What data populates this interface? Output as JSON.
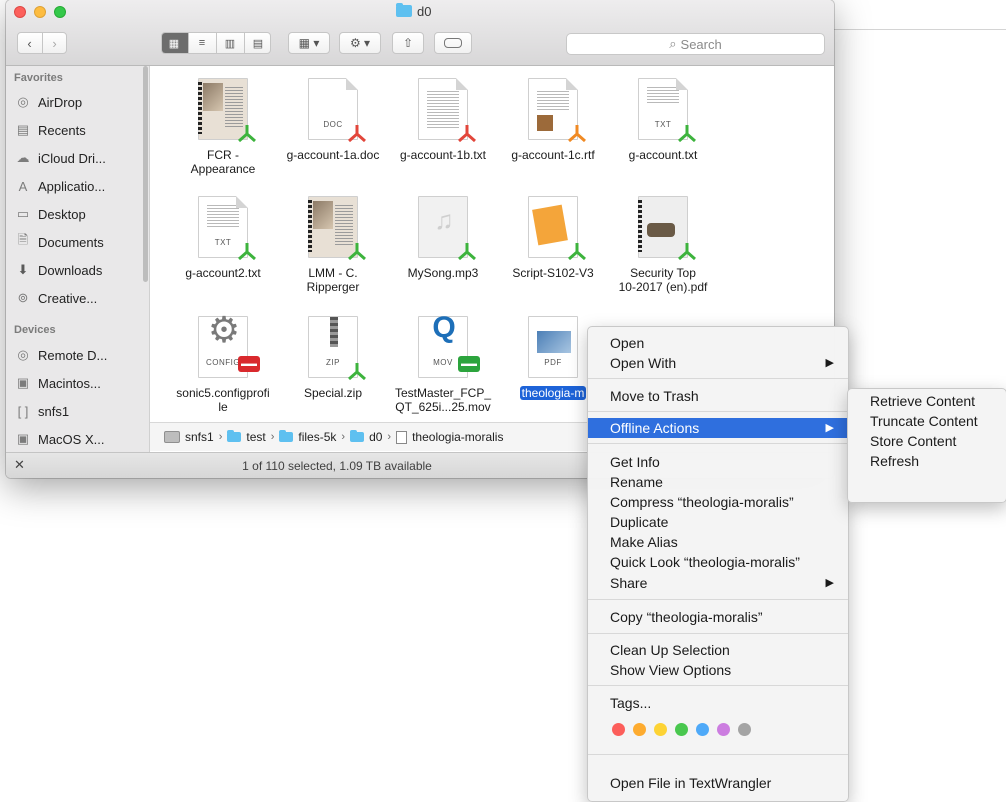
{
  "window": {
    "title": "d0",
    "search_placeholder": "Search",
    "status": "1 of 110 selected, 1.09 TB available",
    "toolbar": {
      "back_icon": "chevron-left-icon",
      "forward_icon": "chevron-right-icon",
      "view_modes": [
        "icon-view",
        "list-view",
        "column-view",
        "cover-flow"
      ],
      "arrange_icon": "arrange-icon",
      "action_icon": "gear-icon",
      "share_icon": "share-icon",
      "tag_icon": "tag-icon"
    }
  },
  "sidebar": {
    "favorites_heading": "Favorites",
    "favorites": [
      {
        "label": "AirDrop",
        "icon": "airdrop-icon"
      },
      {
        "label": "Recents",
        "icon": "recents-icon"
      },
      {
        "label": "iCloud Dri...",
        "icon": "cloud-icon"
      },
      {
        "label": "Applicatio...",
        "icon": "applications-icon"
      },
      {
        "label": "Desktop",
        "icon": "desktop-icon"
      },
      {
        "label": "Documents",
        "icon": "documents-icon"
      },
      {
        "label": "Downloads",
        "icon": "downloads-icon"
      },
      {
        "label": "Creative...",
        "icon": "creative-cloud-icon"
      }
    ],
    "devices_heading": "Devices",
    "devices": [
      {
        "label": "Remote D...",
        "icon": "remote-disc-icon"
      },
      {
        "label": "Macintos...",
        "icon": "hard-drive-icon"
      },
      {
        "label": "snfs1",
        "icon": "network-volume-icon"
      },
      {
        "label": "MacOS X...",
        "icon": "hard-drive-icon"
      }
    ]
  },
  "files": [
    {
      "name": "FCR -\nAppearance"
    },
    {
      "name": "g-account-1a.doc",
      "type": "DOC"
    },
    {
      "name": "g-account-1b.txt"
    },
    {
      "name": "g-account-1c.rtf"
    },
    {
      "name": "g-account.txt",
      "type": "TXT"
    },
    {
      "name": "g-account2.txt",
      "type": "TXT"
    },
    {
      "name": "LMM - C.\nRipperger"
    },
    {
      "name": "MySong.mp3"
    },
    {
      "name": "Script-S102-V3"
    },
    {
      "name": "Security Top\n10-2017 (en).pdf"
    },
    {
      "name": "sonic5.configprofi\nle",
      "type": "CONFIG"
    },
    {
      "name": "Special.zip",
      "type": "ZIP"
    },
    {
      "name": "TestMaster_FCP_\nQT_625i...25.mov",
      "type": "MOV"
    },
    {
      "name": "theologia-m",
      "type": "PDF",
      "selected": true
    }
  ],
  "pathbar": [
    "snfs1",
    "test",
    "files-5k",
    "d0",
    "theologia-moralis"
  ],
  "context_menu": {
    "items": [
      {
        "label": "Open"
      },
      {
        "label": "Open With",
        "submenu": true
      },
      {
        "label": "Move to Trash"
      },
      {
        "label": "Offline Actions",
        "submenu": true,
        "highlighted": true
      },
      {
        "label": "Get Info"
      },
      {
        "label": "Rename"
      },
      {
        "label": "Compress “theologia-moralis”"
      },
      {
        "label": "Duplicate"
      },
      {
        "label": "Make Alias"
      },
      {
        "label": "Quick Look “theologia-moralis”"
      },
      {
        "label": "Share",
        "submenu": true
      },
      {
        "label": "Copy “theologia-moralis”"
      },
      {
        "label": "Clean Up Selection"
      },
      {
        "label": "Show View Options"
      },
      {
        "label": "Tags..."
      },
      {
        "label": "Open File in TextWrangler"
      }
    ],
    "tag_colors": [
      "#fc5e5a",
      "#fdab2f",
      "#fdd334",
      "#49c74e",
      "#4ea9f8",
      "#cc7de0",
      "#a4a4a4"
    ]
  },
  "submenu": {
    "items": [
      "Retrieve Content",
      "Truncate Content",
      "Store Content",
      "Refresh"
    ]
  }
}
